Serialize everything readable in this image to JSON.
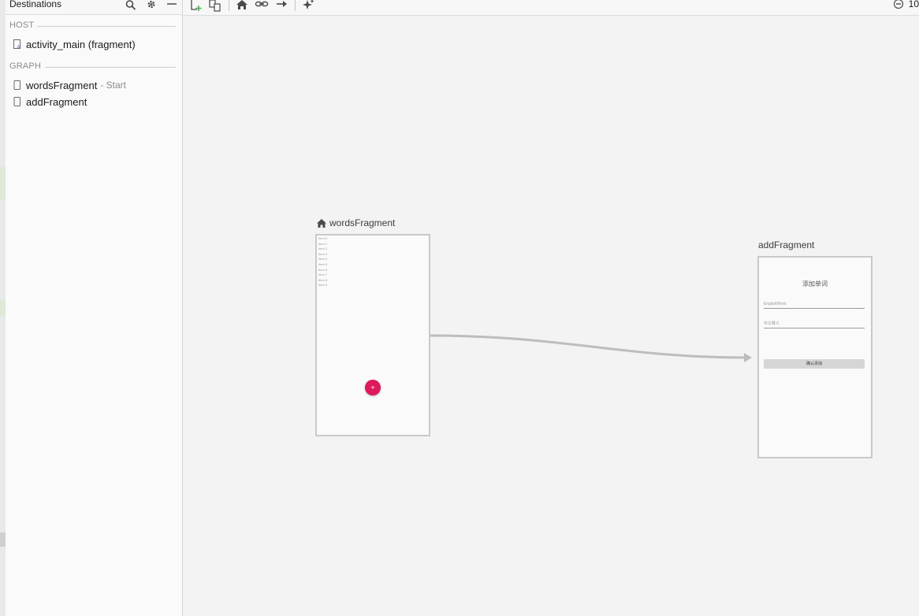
{
  "panel": {
    "title": "Destinations",
    "host_label": "HOST",
    "graph_label": "GRAPH",
    "host_items": [
      {
        "name": "activity_main (fragment)",
        "suffix": ""
      }
    ],
    "graph_items": [
      {
        "name": "wordsFragment",
        "suffix": "- Start"
      },
      {
        "name": "addFragment",
        "suffix": ""
      }
    ]
  },
  "toolbar": {
    "zoom": "10"
  },
  "canvas": {
    "words_fragment": {
      "label": "wordsFragment",
      "list_items": [
        "Item 0",
        "Item 1",
        "Item 2",
        "Item 3",
        "Item 4",
        "Item 5",
        "Item 6",
        "Item 7",
        "Item 8",
        "Item 9"
      ],
      "fab_label": "+"
    },
    "add_fragment": {
      "label": "addFragment",
      "title": "添加单词",
      "english_hint": "EnglishWord",
      "chinese_hint": "中文释义",
      "button_label": "确认添加"
    }
  },
  "colors": {
    "fab": "#dd1a5b",
    "action_arrow": "#bdbdbd",
    "frame_border": "#c9c9c9"
  }
}
